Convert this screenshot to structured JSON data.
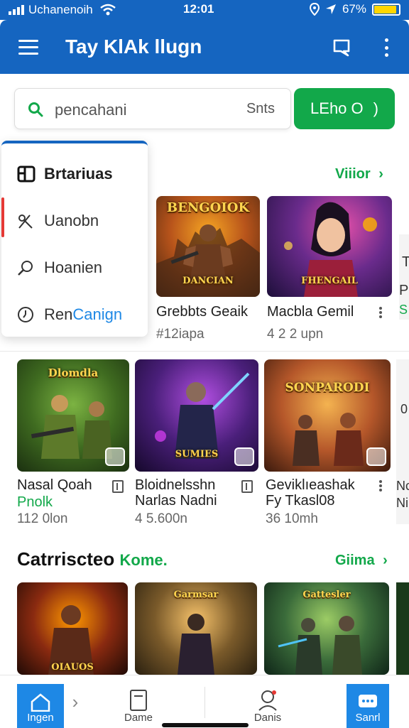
{
  "status_bar": {
    "carrier": "Uchanenoih",
    "time": "12:01",
    "battery": "67%",
    "battery_level": 0.9,
    "icons": [
      "signal-icon",
      "wifi-icon",
      "location-icon",
      "navigation-icon",
      "battery-icon"
    ]
  },
  "appbar": {
    "title": "Tay KlAk llugn",
    "icons": [
      "menu-icon",
      "chat-icon",
      "more-icon"
    ]
  },
  "search": {
    "placeholder": "pencahani",
    "tail": "Snts",
    "icon": "search-icon"
  },
  "cta": {
    "label": "LEho O",
    "chevron": ")"
  },
  "drawer": {
    "header": "Brtariuas",
    "items": [
      {
        "label": "Uanobn",
        "icon": "scissors-icon",
        "active": true
      },
      {
        "label": "Hoanien",
        "icon": "search-loupe-icon",
        "active": false
      },
      {
        "label": "RenCanign",
        "icon": "clock-icon",
        "active": false,
        "highlight_prefix": "Ren",
        "highlight_rest": "Canign"
      }
    ]
  },
  "row1": {
    "more_label": "Viiior",
    "more_chevron": "›",
    "cards": [
      {
        "art": "BENGOIOK",
        "art_caption": "DANCIAN",
        "title": "Grebbts Geaik",
        "sub": "#12iapa"
      },
      {
        "art": "",
        "art_caption": "FHENGAIL",
        "title": "Macbla Gemil",
        "sub": "4 2 2 upn"
      }
    ],
    "peek_texts": [
      "T",
      "P",
      "S"
    ]
  },
  "row2": {
    "cards": [
      {
        "art": "Dlomdla",
        "title": "Nasal Qoah",
        "green": "Pnolk",
        "sub": "112 0lon"
      },
      {
        "art": "SUMIES",
        "title": "Bloidnelsshn",
        "title2": "Narlas Nadni",
        "sub": "4 5.600n"
      },
      {
        "art": "SONPARODI",
        "title": "Geviklıeashak",
        "title2": "Fy Tkasl08",
        "sub": "36 10mh"
      }
    ],
    "peek_texts": [
      "0",
      "Nc",
      "Ni"
    ]
  },
  "section": {
    "title": "Catrriscteo",
    "accent": "Kome.",
    "more_label": "Giima",
    "more_chevron": "›"
  },
  "row3": {
    "cards": [
      {
        "art": "OIAUOS"
      },
      {
        "art": "Garmsar"
      },
      {
        "art": "Gattesler"
      }
    ]
  },
  "bottom_nav": [
    {
      "label": "Ingen",
      "icon": "home-icon",
      "active": true
    },
    {
      "label": "›",
      "icon": "chevron-right-icon",
      "active": false
    },
    {
      "label": "Dame",
      "icon": "document-icon",
      "active": false
    },
    {
      "label": "Danis",
      "icon": "profile-icon",
      "active": false
    },
    {
      "label": "Sanrl",
      "icon": "chat-bubble-icon",
      "active": true
    }
  ],
  "colors": {
    "primary": "#1565c0",
    "accent_green": "#12a84a",
    "active_red": "#e53935",
    "battery_yellow": "#ffd600"
  }
}
